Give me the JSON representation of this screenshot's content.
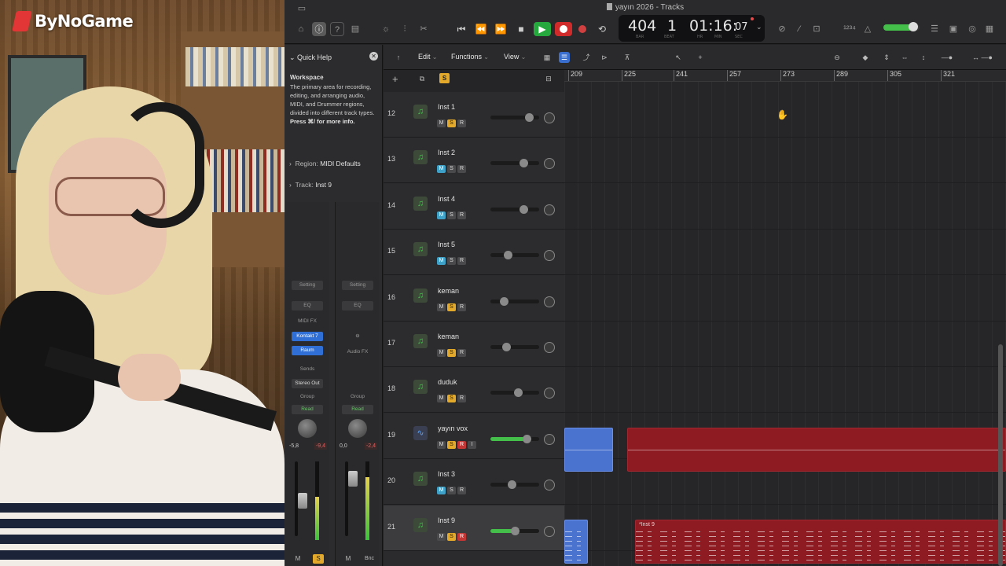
{
  "overlay": {
    "logo_text": "ByNoGame"
  },
  "window": {
    "title": "yayın 2026 - Tracks"
  },
  "lcd": {
    "bar": "404",
    "beat": "1",
    "time": "01:16:",
    "frames": "07",
    "labels": [
      "BAR",
      "BEAT",
      "HR",
      "MIN",
      "SEC"
    ]
  },
  "quick_help": {
    "heading": "Quick Help",
    "title": "Workspace",
    "body": "The primary area for recording, editing, and arranging audio, MIDI, and Drummer regions, divided into different track types.",
    "more": "Press ⌘/ for more info."
  },
  "region_section": {
    "label": "Region:",
    "value": "MIDI Defaults"
  },
  "track_section": {
    "label": "Track:",
    "value": "Inst 9"
  },
  "strip1": {
    "setting": "Setting",
    "eq": "EQ",
    "midi_fx": "MIDI FX",
    "plugin1": "Kontakt 7",
    "plugin2": "Raum",
    "sends": "Sends",
    "output": "Stereo Out",
    "group": "Group",
    "automation": "Read",
    "val_left": "-5,8",
    "val_right": "-9,4",
    "m": "M",
    "s": "S",
    "level": 0.55
  },
  "strip2": {
    "setting": "Setting",
    "eq": "EQ",
    "audio_fx": "Audio FX",
    "group": "Group",
    "automation": "Read",
    "val_left": "0,0",
    "val_right": "-2,4",
    "m": "M",
    "bnc": "Bnc",
    "level": 0.8
  },
  "toolbar": {
    "edit": "Edit",
    "functions": "Functions",
    "view": "View"
  },
  "track_header": {
    "add": "+",
    "solo": "S"
  },
  "ruler": {
    "marks": [
      "209",
      "225",
      "241",
      "257",
      "273",
      "289",
      "305",
      "321"
    ]
  },
  "tracks": [
    {
      "num": "12",
      "name": "Inst 1",
      "type": "midi",
      "m_blue": false,
      "solo": true,
      "vol": 0.85
    },
    {
      "num": "13",
      "name": "Inst 2",
      "type": "midi",
      "m_blue": true,
      "solo": false,
      "vol": 0.72
    },
    {
      "num": "14",
      "name": "Inst 4",
      "type": "midi",
      "m_blue": true,
      "solo": false,
      "vol": 0.72
    },
    {
      "num": "15",
      "name": "Inst 5",
      "type": "midi",
      "m_blue": true,
      "solo": false,
      "vol": 0.33
    },
    {
      "num": "16",
      "name": "keman",
      "type": "midi",
      "m_blue": false,
      "solo": true,
      "vol": 0.24
    },
    {
      "num": "17",
      "name": "keman",
      "type": "midi",
      "m_blue": false,
      "solo": true,
      "vol": 0.29
    },
    {
      "num": "18",
      "name": "duduk",
      "type": "midi",
      "m_blue": false,
      "solo": true,
      "vol": 0.58
    },
    {
      "num": "19",
      "name": "yayın vox",
      "type": "audio",
      "m_blue": false,
      "solo": true,
      "vol": 0.78,
      "rec": true,
      "input": "I"
    },
    {
      "num": "20",
      "name": "Inst 3",
      "type": "midi",
      "m_blue": true,
      "solo": false,
      "vol": 0.43
    },
    {
      "num": "21",
      "name": "Inst 9",
      "type": "midi",
      "m_blue": false,
      "solo": true,
      "vol": 0.5,
      "rec": true
    }
  ],
  "regions": {
    "inst9_name": "*Inst 9"
  },
  "colors": {
    "accent_green": "#44c04a",
    "region_red": "#8e1a22",
    "region_blue": "#4a72cf",
    "solo_yellow": "#e3a92a",
    "record_red": "#d02a2a"
  }
}
